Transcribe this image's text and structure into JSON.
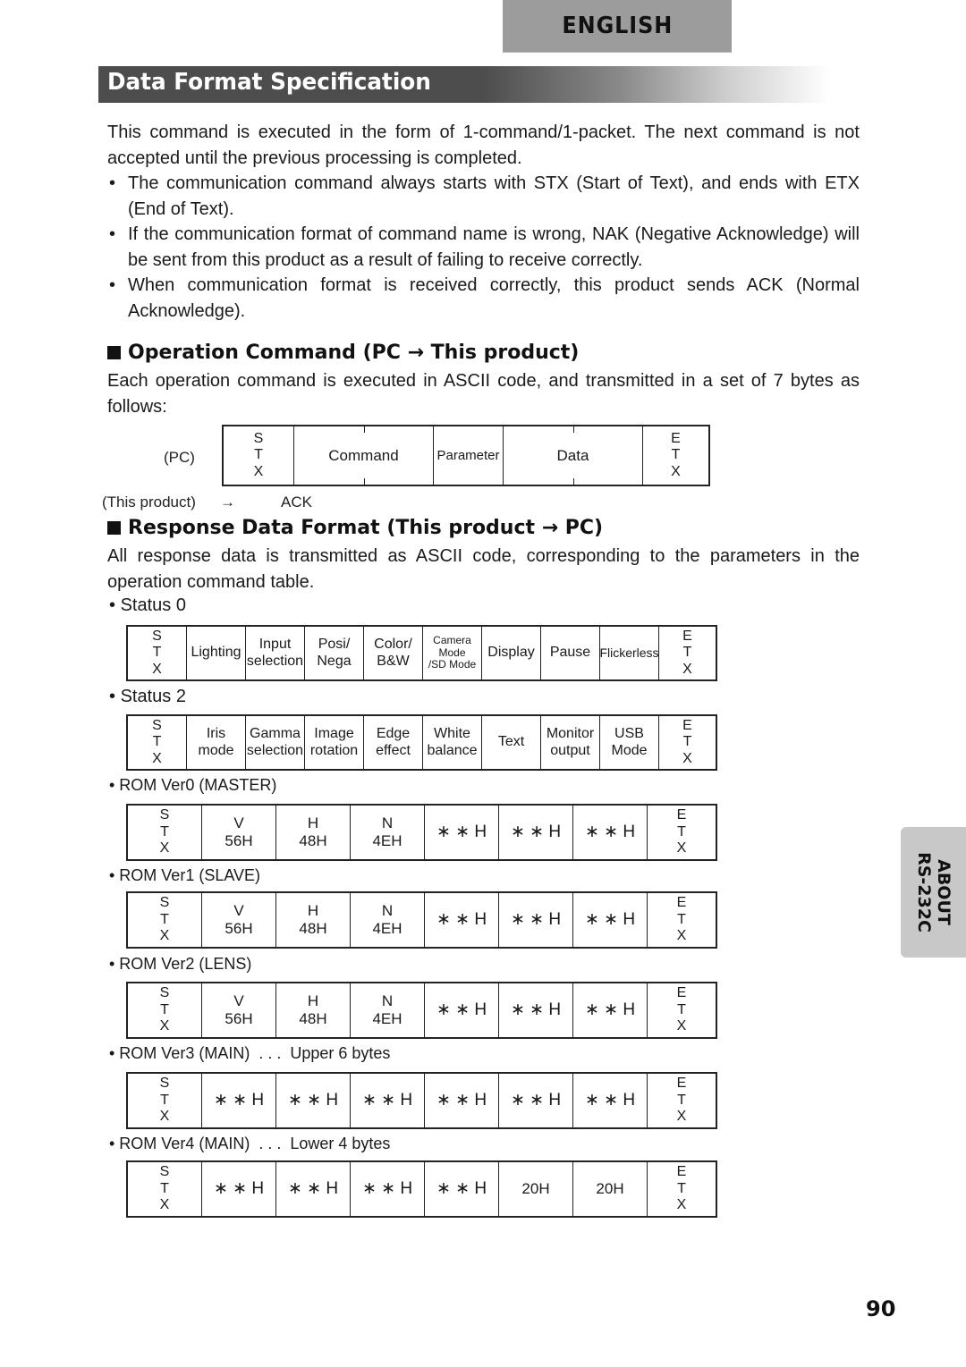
{
  "header": {
    "language_tab": "ENGLISH",
    "section_title": "Data Format Specification"
  },
  "intro": {
    "paragraph": "This command is executed in the form of 1-command/1-packet. The next command is not accepted until the previous processing is completed.",
    "bullets": [
      "The communication command always starts with STX (Start of Text), and ends with ETX (End of Text).",
      "If the communication format of command name is wrong, NAK (Negative Acknowledge) will be sent from this product as a result of failing to receive correctly.",
      "When communication format is received correctly, this product sends ACK (Normal Acknowledge)."
    ],
    "bullet_symbol": "•"
  },
  "operation_command": {
    "heading": "Operation Command (PC → This product)",
    "description": "Each operation command is executed in ASCII code, and transmitted in a set of 7 bytes as follows:",
    "pc_label": "(PC)",
    "product_label": "(This product)",
    "arrow": "→",
    "ack": "ACK",
    "stx": [
      "S",
      "T",
      "X"
    ],
    "etx": [
      "E",
      "T",
      "X"
    ],
    "fields": [
      "Command",
      "Parameter",
      "Data"
    ]
  },
  "response_format": {
    "heading": "Response Data Format (This product → PC)",
    "description": "All response data is transmitted as ASCII code, corresponding to the parameters in the operation command table.",
    "status0": {
      "label": "Status 0",
      "fields": [
        "Lighting",
        "Input selection",
        "Posi/ Nega",
        "Color/ B&W",
        "Camera Mode /SD Mode",
        "Display",
        "Pause",
        "Flickerless"
      ]
    },
    "status2": {
      "label": "Status 2",
      "fields": [
        "Iris mode",
        "Gamma selection",
        "Image rotation",
        "Edge effect",
        "White balance",
        "Text",
        "Monitor output",
        "USB Mode"
      ]
    },
    "rom_tables": [
      {
        "label": "ROM Ver0 (MASTER)",
        "cells": [
          "V\n56H",
          "H\n48H",
          "N\n4EH",
          "＊＊H",
          "＊＊H",
          "＊＊H"
        ]
      },
      {
        "label": "ROM Ver1 (SLAVE)",
        "cells": [
          "V\n56H",
          "H\n48H",
          "N\n4EH",
          "＊＊H",
          "＊＊H",
          "＊＊H"
        ]
      },
      {
        "label": "ROM Ver2 (LENS)",
        "cells": [
          "V\n56H",
          "H\n48H",
          "N\n4EH",
          "＊＊H",
          "＊＊H",
          "＊＊H"
        ]
      },
      {
        "label": "ROM Ver3 (MAIN)  . . .  Upper 6 bytes",
        "cells": [
          "＊＊H",
          "＊＊H",
          "＊＊H",
          "＊＊H",
          "＊＊H",
          "＊＊H"
        ]
      },
      {
        "label": "ROM Ver4 (MAIN)  . . .  Lower 4 bytes",
        "cells": [
          "＊＊H",
          "＊＊H",
          "＊＊H",
          "＊＊H",
          "20H",
          "20H"
        ]
      }
    ]
  },
  "side_tab": {
    "line1": "ABOUT",
    "line2": "RS-232C"
  },
  "page_number": "90"
}
